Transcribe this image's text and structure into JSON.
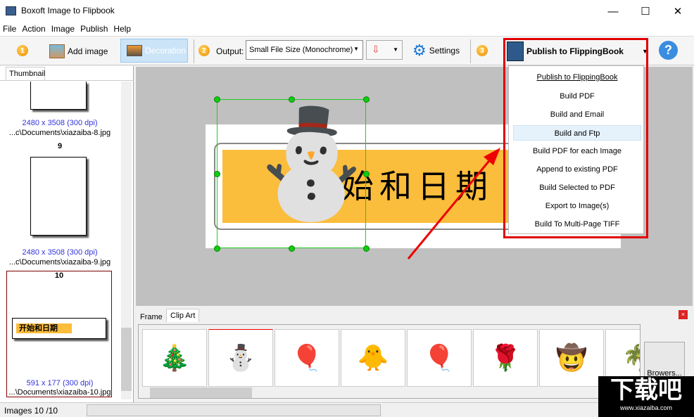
{
  "window": {
    "title": "Boxoft Image to Flipbook",
    "minimize": "—",
    "maximize": "☐",
    "close": "✕"
  },
  "menu": [
    "File",
    "Action",
    "Image",
    "Publish",
    "Help"
  ],
  "toolbar": {
    "step1": "1",
    "add_image": "Add image",
    "decoration": "Decoration",
    "step2": "2",
    "output_label": "Output:",
    "output_value": "Small File Size (Monochrome)",
    "settings": "Settings",
    "step3": "3",
    "publish": "Publish to FlippingBook",
    "help": "?"
  },
  "publish_menu": [
    "Publish to FlippingBook",
    "Build PDF",
    "Build and Email",
    "Build and Ftp",
    "Build PDF for each Image",
    "Append to existing PDF",
    "Build Selected to PDF",
    "Export to Image(s)",
    "Build To Multi-Page TIFF"
  ],
  "publish_menu_selected": "Build and Ftp",
  "thumbnails": {
    "tab": "Thumbnail",
    "items": [
      {
        "dims": "2480 x 3508 (300 dpi)",
        "path": "...c\\Documents\\xiazaiba-8.jpg"
      },
      {
        "num": "9",
        "dims": "2480 x 3508 (300 dpi)",
        "path": "...c\\Documents\\xiazaiba-9.jpg"
      },
      {
        "num": "10",
        "dims": "591 x 177 (300 dpi)",
        "path": "...\\Documents\\xiazaiba-10.jpg",
        "banner": "开始和日期"
      }
    ]
  },
  "canvas": {
    "banner_text": "开始和日期"
  },
  "bottom": {
    "tabs": [
      "Frame",
      "Clip Art"
    ],
    "active_tab": "Clip Art",
    "clipart": [
      "🎄",
      "⛄",
      "🎈",
      "🐥",
      "🎈",
      "🌹",
      "🤠",
      "🌴"
    ],
    "browse": "Browers..."
  },
  "status": {
    "images": "Images 10 /10"
  },
  "watermark": {
    "text": "下载吧",
    "url": "www.xiazaiba.com"
  },
  "colors": {
    "highlight": "#e00000",
    "dim_text": "#3333dd",
    "selection": "#22cc22"
  }
}
